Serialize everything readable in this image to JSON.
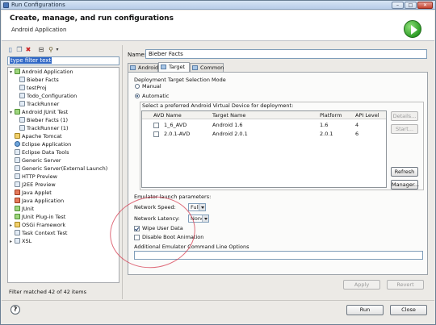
{
  "window": {
    "title": "Run Configurations",
    "controls": [
      "minimize",
      "maximize",
      "close"
    ]
  },
  "header": {
    "title": "Create, manage, and run configurations",
    "subtitle": "Android Application",
    "run_icon": "run-icon"
  },
  "left": {
    "toolbar_icons": [
      "new-config-icon",
      "duplicate-icon",
      "delete-icon",
      "collapse-all-icon",
      "filter-icon"
    ],
    "filter_placeholder": "type filter text",
    "tree": [
      {
        "label": "Android Application",
        "level": 0,
        "expanded": true,
        "icon": "android-icon"
      },
      {
        "label": "Bieber Facts",
        "level": 1,
        "icon": "config-icon"
      },
      {
        "label": "testProj",
        "level": 1,
        "icon": "config-icon"
      },
      {
        "label": "Todo_Configuration",
        "level": 1,
        "icon": "config-icon"
      },
      {
        "label": "TrackRunner",
        "level": 1,
        "icon": "config-icon"
      },
      {
        "label": "Android JUnit Test",
        "level": 0,
        "expanded": true,
        "icon": "junit-icon"
      },
      {
        "label": "Bieber Facts (1)",
        "level": 1,
        "icon": "config-icon"
      },
      {
        "label": "TrackRunner (1)",
        "level": 1,
        "icon": "config-icon"
      },
      {
        "label": "Apache Tomcat",
        "level": 0,
        "icon": "tomcat-icon"
      },
      {
        "label": "Eclipse Application",
        "level": 0,
        "icon": "eclipse-icon"
      },
      {
        "label": "Eclipse Data Tools",
        "level": 0,
        "icon": "data-tools-icon"
      },
      {
        "label": "Generic Server",
        "level": 0,
        "icon": "server-icon"
      },
      {
        "label": "Generic Server(External Launch)",
        "level": 0,
        "icon": "server-icon"
      },
      {
        "label": "HTTP Preview",
        "level": 0,
        "icon": "http-icon"
      },
      {
        "label": "J2EE Preview",
        "level": 0,
        "icon": "j2ee-icon"
      },
      {
        "label": "Java Applet",
        "level": 0,
        "icon": "applet-icon"
      },
      {
        "label": "Java Application",
        "level": 0,
        "icon": "java-app-icon"
      },
      {
        "label": "JUnit",
        "level": 0,
        "icon": "junit-icon"
      },
      {
        "label": "JUnit Plug-in Test",
        "level": 0,
        "icon": "junit-icon"
      },
      {
        "label": "OSGi Framework",
        "level": 0,
        "expanded": false,
        "icon": "osgi-icon"
      },
      {
        "label": "Task Context Test",
        "level": 0,
        "icon": "task-icon"
      },
      {
        "label": "XSL",
        "level": 0,
        "expanded": false,
        "icon": "xsl-icon"
      }
    ],
    "status": "Filter matched 42 of 42 items"
  },
  "right": {
    "name_label": "Name:",
    "name_value": "Bieber Facts",
    "tabs": [
      {
        "label": "Android",
        "active": false
      },
      {
        "label": "Target",
        "active": true
      },
      {
        "label": "Common",
        "active": false
      }
    ],
    "deployment_title": "Deployment Target Selection Mode",
    "mode_manual": "Manual",
    "mode_automatic": "Automatic",
    "avd_prompt": "Select a preferred Android Virtual Device for deployment:",
    "avd_columns": [
      "AVD Name",
      "Target Name",
      "Platform",
      "API Level"
    ],
    "avd_rows": [
      {
        "name": "1_6_AVD",
        "target": "Android 1.6",
        "platform": "1.6",
        "api": "4",
        "checked": false
      },
      {
        "name": "2.0.1-AVD",
        "target": "Android 2.0.1",
        "platform": "2.0.1",
        "api": "6",
        "checked": false
      }
    ],
    "avd_buttons": {
      "details": "Details...",
      "start": "Start...",
      "refresh": "Refresh",
      "manager": "Manager..."
    },
    "emulator_title": "Emulator launch parameters:",
    "network_speed_label": "Network Speed:",
    "network_speed_value": "Full",
    "network_latency_label": "Network Latency:",
    "network_latency_value": "None",
    "wipe_user_data": "Wipe User Data",
    "wipe_checked": true,
    "disable_boot_animation": "Disable Boot Animation",
    "disable_boot_checked": false,
    "cmd_label": "Additional Emulator Command Line Options",
    "cmd_value": "",
    "apply": "Apply",
    "revert": "Revert"
  },
  "footer": {
    "help_icon": "help-icon",
    "run": "Run",
    "close": "Close"
  },
  "colors": {
    "accent": "#3168c6",
    "annotation": "#d63c50",
    "window_bg": "#eceae6"
  }
}
